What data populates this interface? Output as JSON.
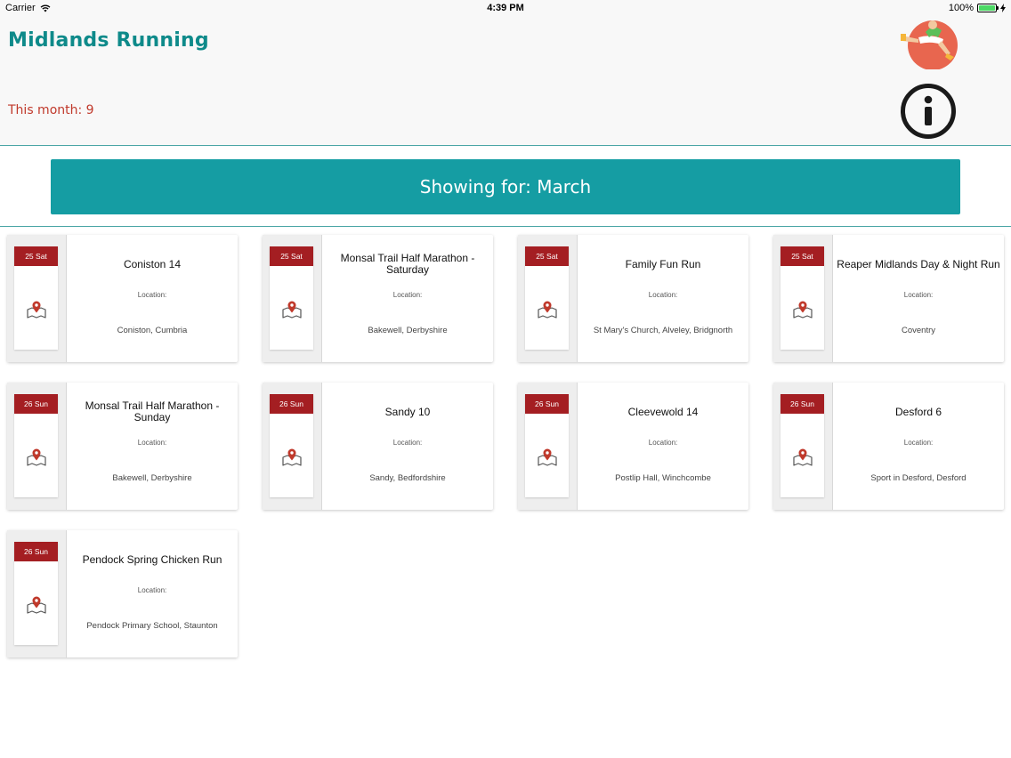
{
  "status_bar": {
    "carrier": "Carrier",
    "time": "4:39 PM",
    "battery": "100%",
    "battery_level": 1.0
  },
  "header": {
    "title": "Midlands Running",
    "month_count": "This month: 9",
    "logo_icon": "runner-logo-icon",
    "info_icon": "info-icon",
    "colors": {
      "title": "#0e8a8a",
      "count": "#c0392b",
      "banner": "#159da3",
      "date_badge": "#a41e22"
    }
  },
  "banner": {
    "label": "Showing for: March"
  },
  "location_label": "Location:",
  "events": [
    {
      "date": "25 Sat",
      "name": "Coniston 14",
      "location": "Coniston, Cumbria"
    },
    {
      "date": "25 Sat",
      "name": "Monsal Trail Half Marathon - Saturday",
      "location": "Bakewell, Derbyshire"
    },
    {
      "date": "25 Sat",
      "name": "Family Fun Run",
      "location": "St Mary's Church, Alveley, Bridgnorth"
    },
    {
      "date": "25 Sat",
      "name": "Reaper Midlands Day & Night Run",
      "location": "Coventry"
    },
    {
      "date": "26 Sun",
      "name": "Monsal Trail Half Marathon - Sunday",
      "location": "Bakewell, Derbyshire"
    },
    {
      "date": "26 Sun",
      "name": "Sandy 10",
      "location": "Sandy, Bedfordshire"
    },
    {
      "date": "26 Sun",
      "name": "Cleevewold 14",
      "location": "Postlip Hall, Winchcombe"
    },
    {
      "date": "26 Sun",
      "name": "Desford 6",
      "location": "Sport in Desford, Desford"
    },
    {
      "date": "26 Sun",
      "name": "Pendock Spring Chicken Run",
      "location": "Pendock Primary School, Staunton"
    }
  ]
}
